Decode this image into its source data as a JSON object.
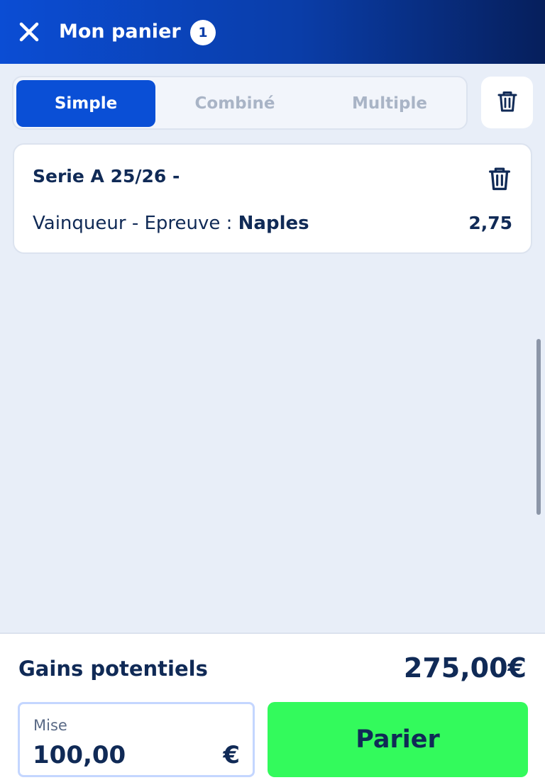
{
  "header": {
    "title": "Mon panier",
    "count": "1",
    "close_icon": "close-icon"
  },
  "tabs": [
    {
      "label": "Simple",
      "active": true
    },
    {
      "label": "Combiné",
      "active": false
    },
    {
      "label": "Multiple",
      "active": false
    }
  ],
  "bet": {
    "title": "Serie A 25/26 -",
    "market": "Vainqueur - Epreuve : ",
    "selection": "Naples",
    "odds": "2,75"
  },
  "footer": {
    "gains_label": "Gains potentiels",
    "gains_value": "275,00€",
    "stake_label": "Mise",
    "stake_value": "100,00",
    "currency": "€",
    "bet_button": "Parier"
  },
  "colors": {
    "primary": "#0a4fd6",
    "bet_button": "#33fa5c",
    "text_dark": "#102a56"
  }
}
